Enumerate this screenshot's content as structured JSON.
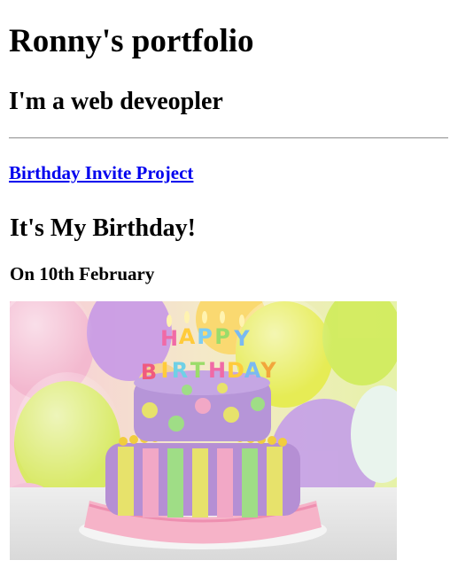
{
  "page": {
    "title": "Ronny's portfolio",
    "subtitle": "I'm a web deveopler",
    "project_link": "Birthday Invite Project"
  },
  "content": {
    "heading": "It's My Birthday!",
    "date": "On 10th February"
  },
  "image": {
    "subject": "birthday-cake-photo",
    "topper_text": "HAPPY BIRTHDAY"
  }
}
